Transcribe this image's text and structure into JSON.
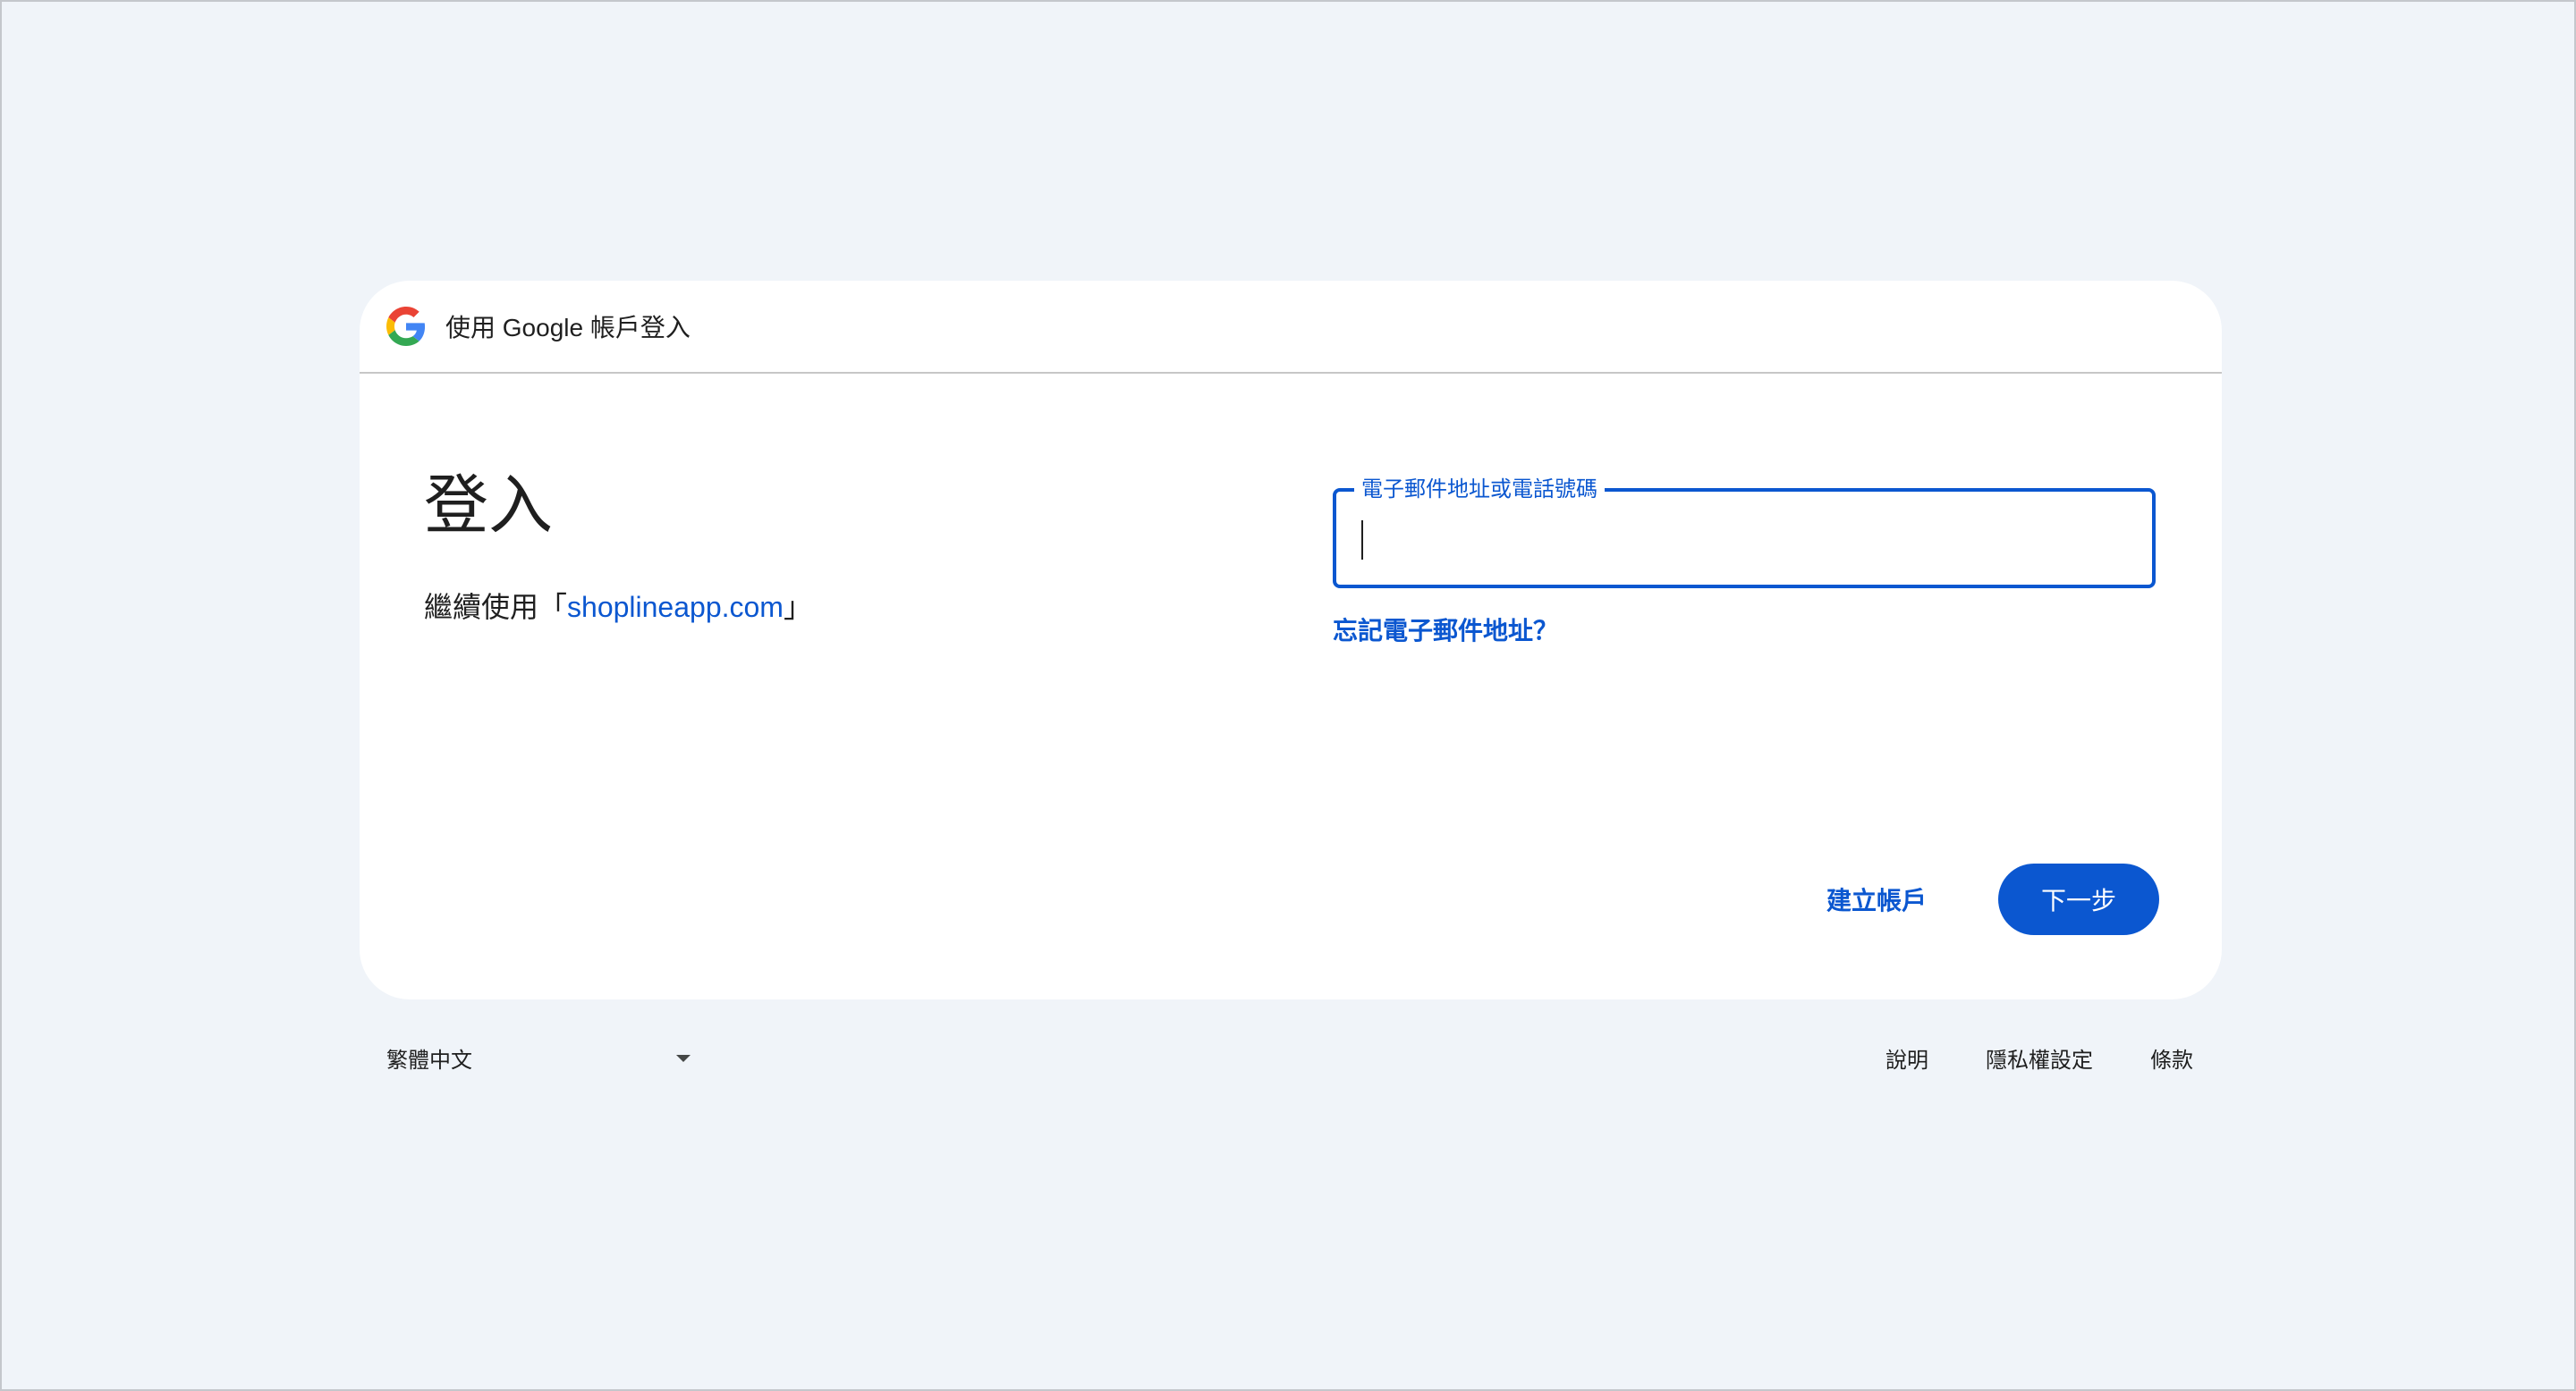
{
  "header": {
    "title": "使用 Google 帳戶登入",
    "logo_icon": "google-g-icon"
  },
  "main": {
    "heading": "登入",
    "subtitle_prefix": "繼續使用「",
    "subtitle_link": "shoplineapp.com",
    "subtitle_suffix": "」",
    "email_field": {
      "label": "電子郵件地址或電話號碼",
      "value": ""
    },
    "forgot_email": "忘記電子郵件地址？",
    "create_account": "建立帳戶",
    "next": "下一步"
  },
  "footer": {
    "language": "繁體中文",
    "links": [
      "說明",
      "隱私權設定",
      "條款"
    ]
  },
  "colors": {
    "accent": "#0b57d0",
    "background": "#f0f4f9",
    "card": "#ffffff",
    "text": "#1f1f1f"
  }
}
